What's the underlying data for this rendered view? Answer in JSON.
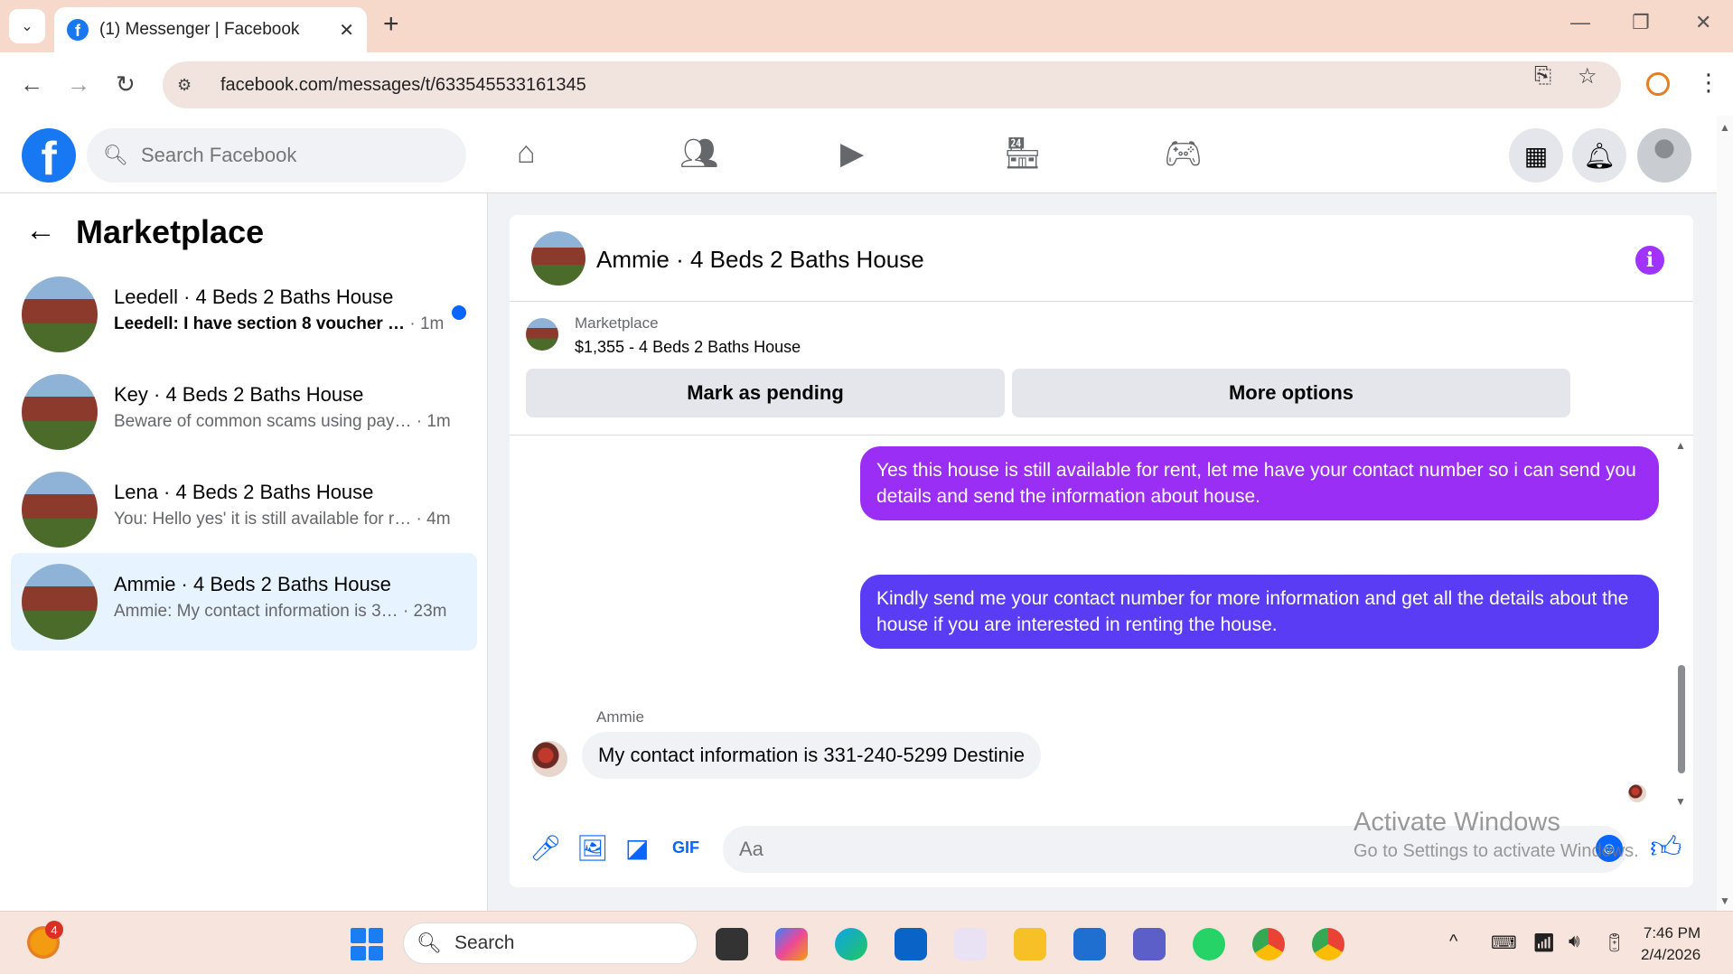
{
  "browser": {
    "tab_title": "(1) Messenger | Facebook",
    "url": "facebook.com/messages/t/633545533161345"
  },
  "fb_header": {
    "search_placeholder": "Search Facebook"
  },
  "sidebar": {
    "title": "Marketplace",
    "conversations": [
      {
        "name": "Leedell · 4 Beds 2 Baths House",
        "preview": "Leedell: I have section 8 voucher …",
        "time": "· 1m",
        "unread": true
      },
      {
        "name": "Key · 4 Beds 2 Baths House",
        "preview": "Beware of common scams using pay…",
        "time": "· 1m",
        "unread": false
      },
      {
        "name": "Lena · 4 Beds 2 Baths House",
        "preview": "You: Hello yes' it is still available for r…",
        "time": "· 4m",
        "unread": false
      },
      {
        "name": "Ammie · 4 Beds 2 Baths House",
        "preview": "Ammie: My contact information is 3…",
        "time": "· 23m",
        "unread": false
      }
    ]
  },
  "chat": {
    "title": "Ammie · 4 Beds 2 Baths House",
    "marketplace_label": "Marketplace",
    "listing": "$1,355 - 4 Beds 2 Baths House",
    "mark_pending_label": "Mark as pending",
    "more_options_label": "More options",
    "messages": [
      {
        "text": "Yes this house is still available for rent, let me have your contact number so i can send you details and send the information about house."
      },
      {
        "text": "Kindly send me your contact number for more information and get all the details about the house if you are interested in renting the house."
      }
    ],
    "incoming_sender": "Ammie",
    "incoming_text": "My contact information is 331-240-5299 Destinie",
    "composer_placeholder": "Aa"
  },
  "watermark": {
    "line1": "Activate Windows",
    "line2": "Go to Settings to activate Windows."
  },
  "taskbar": {
    "weather_badge": "4",
    "search_label": "Search",
    "time": "7:46 PM",
    "date": "2/4/2026"
  },
  "colors": {
    "fb_blue": "#1877f2",
    "msg_purple": "#a033ff",
    "msg_indigo": "#5b3cf5",
    "active_row": "#e7f3ff"
  }
}
